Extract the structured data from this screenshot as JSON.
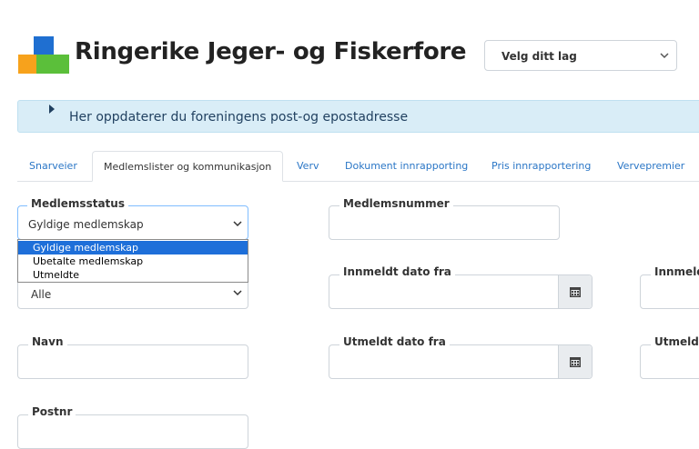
{
  "header": {
    "title": "Ringerike Jeger- og Fiskerfore",
    "team_select_value": "Velg ditt lag",
    "logo_icon": "app-blocks-logo"
  },
  "banner": {
    "text": "Her oppdaterer du foreningens post-og epostadresse"
  },
  "tabs": [
    {
      "label": "Snarveier",
      "active": false
    },
    {
      "label": "Medlemslister og kommunikasjon",
      "active": true
    },
    {
      "label": "Verv",
      "active": false
    },
    {
      "label": "Dokument innrapporting",
      "active": false
    },
    {
      "label": "Pris innrapportering",
      "active": false
    },
    {
      "label": "Vervepremier",
      "active": false
    }
  ],
  "form": {
    "medlemsstatus": {
      "label": "Medlemsstatus",
      "value": "Gyldige medlemskap",
      "options": [
        "Gyldige medlemskap",
        "Ubetalte medlemskap",
        "Utmeldte"
      ],
      "highlighted_option": "Gyldige medlemskap"
    },
    "medlemsnummer": {
      "label": "Medlemsnummer",
      "value": ""
    },
    "second_select": {
      "value": "Alle"
    },
    "innmeldt_fra": {
      "label": "Innmeldt dato fra",
      "value": ""
    },
    "innmeldt_til": {
      "label": "Innmeld"
    },
    "navn": {
      "label": "Navn",
      "value": ""
    },
    "utmeldt_fra": {
      "label": "Utmeldt dato fra",
      "value": ""
    },
    "utmeldt_til": {
      "label": "Utmeldt"
    },
    "postnr": {
      "label": "Postnr",
      "value": ""
    }
  },
  "colors": {
    "accent": "#2a76c6",
    "banner_bg": "#d9edf7",
    "selected_option": "#1e6fd9"
  }
}
